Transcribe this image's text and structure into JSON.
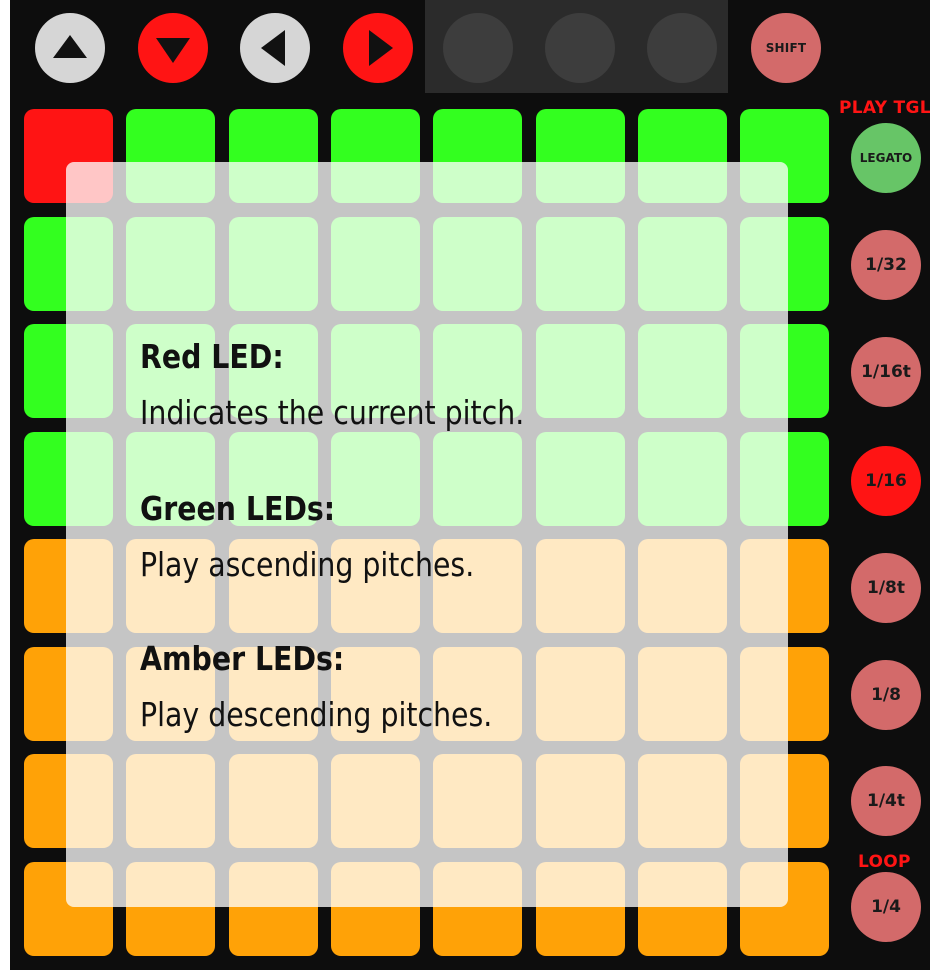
{
  "colors": {
    "red": "#ff1414",
    "green": "#33ff1f",
    "amber": "#ffa207",
    "button_dim_red": "#d36a6a",
    "arrow_white": "#d6d6d6",
    "legato_green": "#67c567",
    "background": "#0d0d0d"
  },
  "top_row": {
    "arrow_up": {
      "icon": "arrow-up-icon",
      "color": "#d6d6d6"
    },
    "arrow_down": {
      "icon": "arrow-down-icon",
      "color": "#ff1414"
    },
    "arrow_left": {
      "icon": "arrow-left-icon",
      "color": "#d6d6d6"
    },
    "arrow_right": {
      "icon": "arrow-right-icon",
      "color": "#ff1414"
    },
    "shift_label": "SHIFT"
  },
  "side_column": {
    "play_tgl_label": "PLAY TGL",
    "loop_label": "LOOP",
    "buttons": [
      {
        "label": "LEGATO",
        "state": "green"
      },
      {
        "label": "1/32",
        "state": "dim"
      },
      {
        "label": "1/16t",
        "state": "dim"
      },
      {
        "label": "1/16",
        "state": "on"
      },
      {
        "label": "1/8t",
        "state": "dim"
      },
      {
        "label": "1/8",
        "state": "dim"
      },
      {
        "label": "1/4t",
        "state": "dim"
      },
      {
        "label": "1/4",
        "state": "dim"
      }
    ]
  },
  "grid": {
    "rows": [
      [
        "red",
        "green",
        "green",
        "green",
        "green",
        "green",
        "green",
        "green"
      ],
      [
        "green",
        "green",
        "green",
        "green",
        "green",
        "green",
        "green",
        "green"
      ],
      [
        "green",
        "green",
        "green",
        "green",
        "green",
        "green",
        "green",
        "green"
      ],
      [
        "green",
        "green",
        "green",
        "green",
        "green",
        "green",
        "green",
        "green"
      ],
      [
        "amber",
        "amber",
        "amber",
        "amber",
        "amber",
        "amber",
        "amber",
        "amber"
      ],
      [
        "amber",
        "amber",
        "amber",
        "amber",
        "amber",
        "amber",
        "amber",
        "amber"
      ],
      [
        "amber",
        "amber",
        "amber",
        "amber",
        "amber",
        "amber",
        "amber",
        "amber"
      ],
      [
        "amber",
        "amber",
        "amber",
        "amber",
        "amber",
        "amber",
        "amber",
        "amber"
      ]
    ]
  },
  "overlay": {
    "red_heading": "Red LED:",
    "red_text": "Indicates the current pitch.",
    "green_heading": "Green LEDs:",
    "green_text": "Play ascending pitches.",
    "amber_heading": "Amber LEDs:",
    "amber_text": "Play descending pitches."
  }
}
